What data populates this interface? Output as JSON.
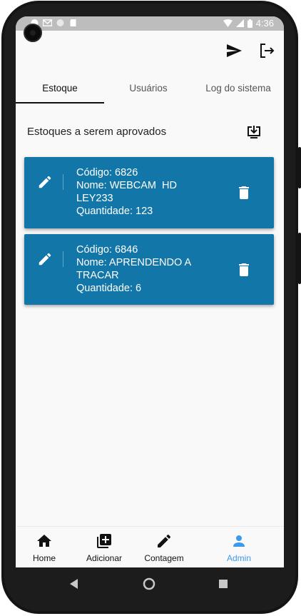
{
  "status_bar": {
    "time": "4:36",
    "icons": [
      "notification-icon",
      "gmail-icon",
      "circle-icon",
      "sd-card-icon",
      "wifi-icon",
      "signal-icon",
      "battery-icon"
    ]
  },
  "header": {
    "actions": [
      "send-icon",
      "logout-icon"
    ]
  },
  "tabs": [
    {
      "label": "Estoque",
      "active": true
    },
    {
      "label": "Usuários",
      "active": false
    },
    {
      "label": "Log do sistema",
      "active": false
    }
  ],
  "section": {
    "title": "Estoques a serem aprovados",
    "action_icon": "download-icon"
  },
  "cards": [
    {
      "code_line": "Código: 6826",
      "name_line1": "Nome: WEBCAM  HD",
      "name_line2": "LEY233",
      "quantity_line": "Quantidade: 123"
    },
    {
      "code_line": "Código: 6846",
      "name_line1": "Nome: APRENDENDO A",
      "name_line2": "TRACAR",
      "quantity_line": "Quantidade: 6"
    }
  ],
  "bottom_nav": [
    {
      "label": "Home",
      "icon": "home-icon",
      "active": false
    },
    {
      "label": "Adicionar",
      "icon": "add-box-icon",
      "active": false
    },
    {
      "label": "Contagem",
      "icon": "pencil-icon",
      "active": false
    },
    {
      "label": "Admin",
      "icon": "person-icon",
      "active": true
    }
  ],
  "colors": {
    "card": "#1277a8",
    "active_nav": "#3d9ae8",
    "status_bar": "#bdbdbd"
  }
}
